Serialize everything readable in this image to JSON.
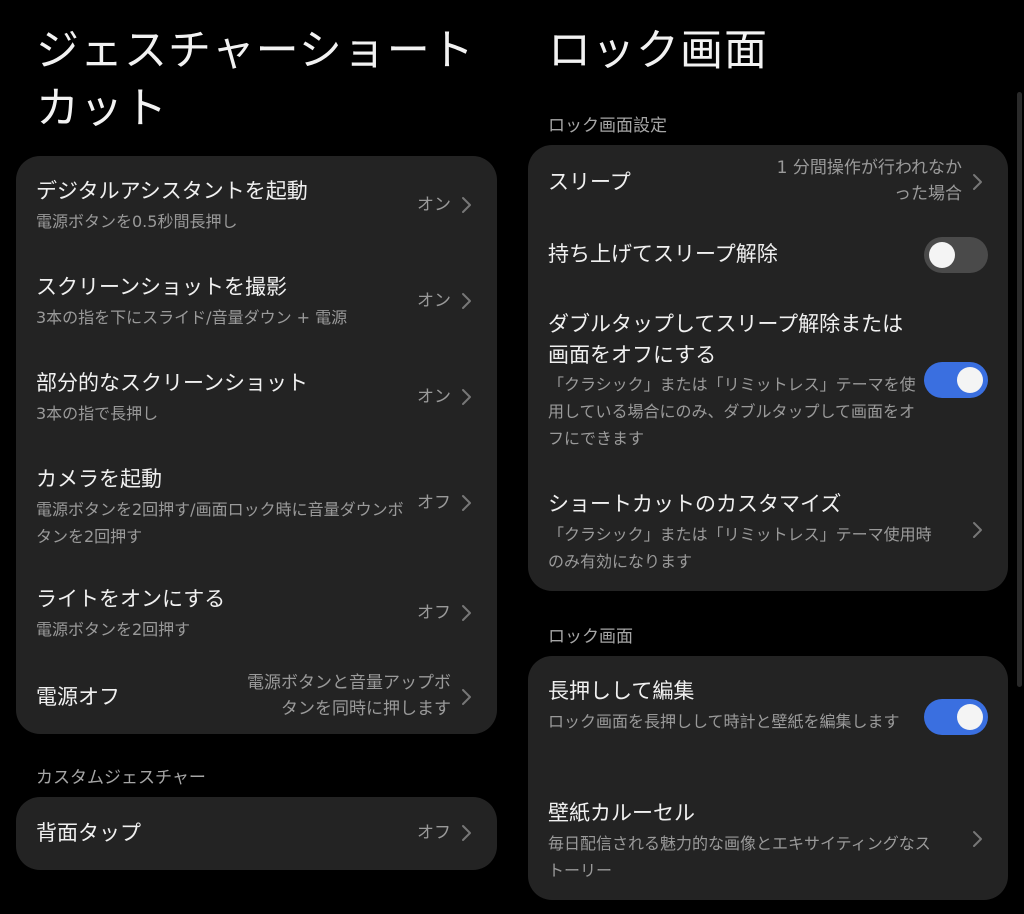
{
  "left": {
    "title": "ジェスチャーショートカット",
    "items": [
      {
        "title": "デジタルアシスタントを起動",
        "subtitle": "電源ボタンを0.5秒間長押し",
        "value": "オン"
      },
      {
        "title": "スクリーンショットを撮影",
        "subtitle": "3本の指を下にスライド/音量ダウン + 電源",
        "value": "オン"
      },
      {
        "title": "部分的なスクリーンショット",
        "subtitle": "3本の指で長押し",
        "value": "オン"
      },
      {
        "title": "カメラを起動",
        "subtitle": "電源ボタンを2回押す/画面ロック時に音量ダウンボタンを2回押す",
        "value": "オフ"
      },
      {
        "title": "ライトをオンにする",
        "subtitle": "電源ボタンを2回押す",
        "value": "オフ"
      },
      {
        "title": "電源オフ",
        "subtitle": "",
        "value": "電源ボタンと音量アップボタンを同時に押します"
      }
    ],
    "custom_section": "カスタムジェスチャー",
    "custom_items": [
      {
        "title": "背面タップ",
        "value": "オフ"
      }
    ]
  },
  "right": {
    "title": "ロック画面",
    "section1": "ロック画面設定",
    "settings": [
      {
        "title": "スリープ",
        "value": "1 分間操作が行われなかった場合"
      },
      {
        "title": "持ち上げてスリープ解除",
        "toggle": "off"
      },
      {
        "title": "ダブルタップしてスリープ解除または画面をオフにする",
        "subtitle": "「クラシック」または「リミットレス」テーマを使用している場合にのみ、ダブルタップして画面をオフにできます",
        "toggle": "on"
      },
      {
        "title": "ショートカットのカスタマイズ",
        "subtitle": "「クラシック」または「リミットレス」テーマ使用時のみ有効になります"
      }
    ],
    "section2": "ロック画面",
    "lock_items": [
      {
        "title": "長押しして編集",
        "subtitle": "ロック画面を長押しして時計と壁紙を編集します",
        "toggle": "on"
      },
      {
        "title": "壁紙カルーセル",
        "subtitle": "毎日配信される魅力的な画像とエキサイティングなストーリー"
      }
    ]
  },
  "colors": {
    "background": "#000000",
    "card": "#232323",
    "toggle_on": "#3a6fe0",
    "toggle_off": "#4a4a4a"
  },
  "icons": {
    "chevron": "chevron-right-icon"
  }
}
